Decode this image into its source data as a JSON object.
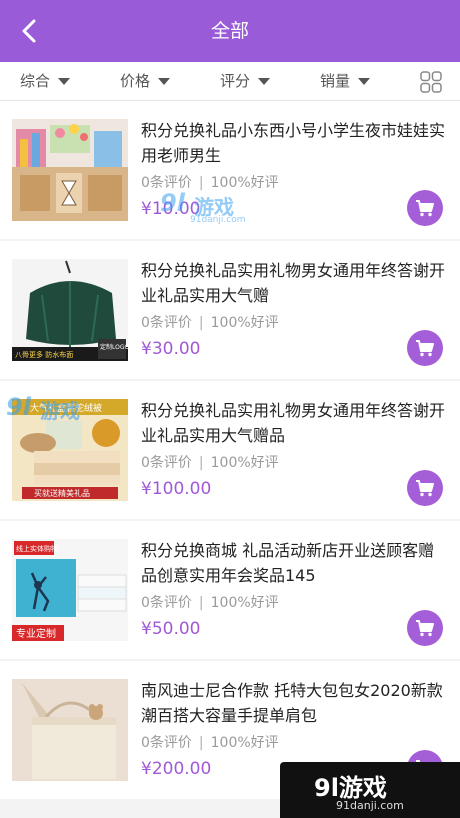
{
  "header": {
    "title": "全部"
  },
  "filters": [
    {
      "label": "综合"
    },
    {
      "label": "价格"
    },
    {
      "label": "评分"
    },
    {
      "label": "销量"
    }
  ],
  "products": [
    {
      "name": "积分兑换礼品小东西小号小学生夜市娃娃实用老师男生",
      "reviews": "0条评价",
      "rating": "100%好评",
      "price": "¥10.00"
    },
    {
      "name": "积分兑换礼品实用礼物男女通用年终答谢开业礼品实用大气赠",
      "reviews": "0条评价",
      "rating": "100%好评",
      "price": "¥30.00"
    },
    {
      "name": "积分兑换礼品实用礼物男女通用年终答谢开业礼品实用大气赠品",
      "reviews": "0条评价",
      "rating": "100%好评",
      "price": "¥100.00"
    },
    {
      "name": "积分兑换商城 礼品活动新店开业送顾客赠品创意实用年会奖品145",
      "reviews": "0条评价",
      "rating": "100%好评",
      "price": "¥50.00"
    },
    {
      "name": "南风迪士尼合作款 托特大包包女2020新款潮百搭大容量手提单肩包",
      "reviews": "0条评价",
      "rating": "100%好评",
      "price": "¥200.00"
    }
  ],
  "thumb_texts": {
    "p2_left": "八骨更多 防水布面",
    "p2_right": "定制LOGO",
    "p3_top": "大气礼盒装驼绒被",
    "p3_bottom": "买就送精美礼品",
    "p4_top": "线上实体购物",
    "p4_bottom": "专业定制"
  },
  "watermark": {
    "brand": "9l游戏",
    "site": "91danji.com"
  },
  "colors": {
    "accent": "#9a5bd8",
    "price": "#a05ad8",
    "cart": "#a45fd8"
  },
  "icons": {
    "back": "chevron-left-icon",
    "cart": "cart-icon",
    "grid": "grid-view-icon",
    "caret": "caret-down-icon"
  }
}
